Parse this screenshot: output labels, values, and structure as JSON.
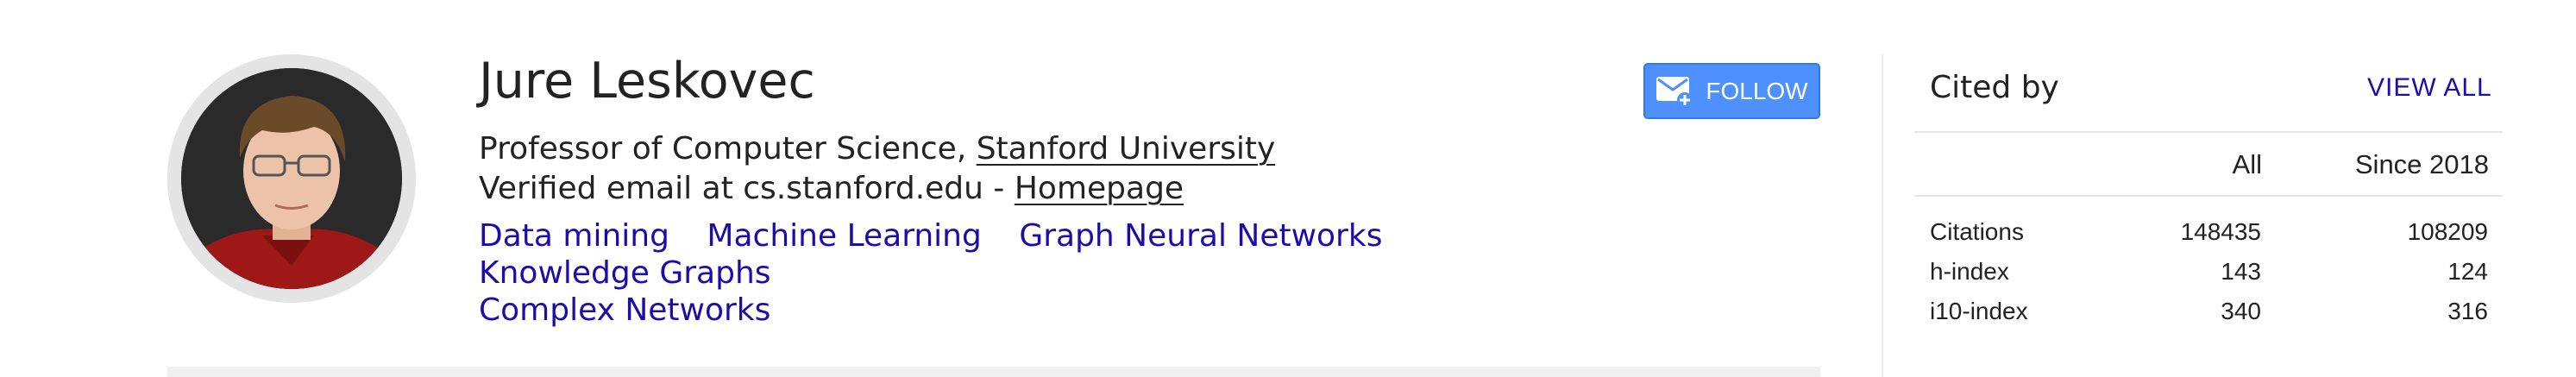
{
  "profile": {
    "name": "Jure Leskovec",
    "affiliation_prefix": "Professor of Computer Science, ",
    "affiliation_link": "Stanford University",
    "email_text": "Verified email at cs.stanford.edu - ",
    "homepage_link": "Homepage",
    "interests": [
      "Data mining",
      "Machine Learning",
      "Graph Neural Networks",
      "Knowledge Graphs",
      "Complex Networks"
    ]
  },
  "follow": {
    "label": "FOLLOW",
    "icon": "mail-plus-icon",
    "color": "#4d90fe"
  },
  "cited_by": {
    "title": "Cited by",
    "view_all": "VIEW ALL",
    "columns": [
      "All",
      "Since 2018"
    ],
    "rows": [
      {
        "label": "Citations",
        "all": "148435",
        "since": "108209"
      },
      {
        "label": "h-index",
        "all": "143",
        "since": "124"
      },
      {
        "label": "i10-index",
        "all": "340",
        "since": "316"
      }
    ]
  },
  "colors": {
    "link": "#1a0dab",
    "button": "#4d90fe"
  }
}
